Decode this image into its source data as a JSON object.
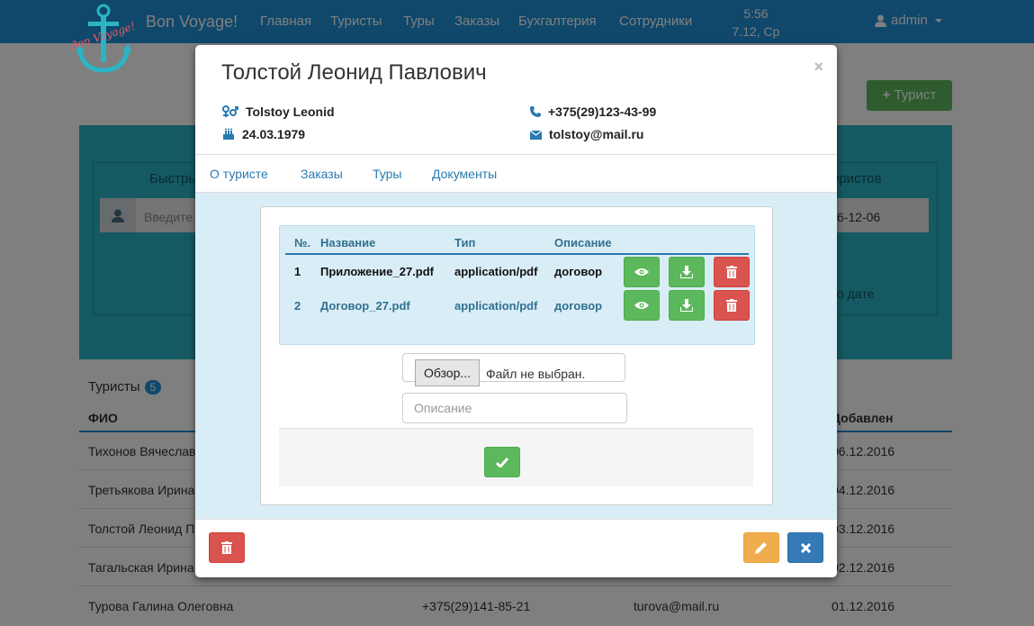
{
  "navbar": {
    "brand": "Bon Voyage!",
    "logo_text": "Bon Voyage!",
    "items": [
      "Главная",
      "Туристы",
      "Туры",
      "Заказы",
      "Бухгалтерия",
      "Сотрудники"
    ],
    "time": "5:56",
    "date": "7.12, Ср",
    "user": "admin"
  },
  "background": {
    "add_button": "Турист",
    "search_title_left": "Быстрь",
    "search_title_right": "уристов",
    "search_placeholder": "Введите",
    "search_date": "6-12-06",
    "by_date": "о дате",
    "list_title": "Туристы",
    "list_count": "5",
    "col_fio": "ФИО",
    "col_added": "Добавлен",
    "rows": [
      {
        "name": "Тихонов Вячеслав",
        "date": "06.12.2016"
      },
      {
        "name": "Третьякова Ирина",
        "date": "04.12.2016"
      },
      {
        "name": "Толстой Леонид П",
        "date": "03.12.2016"
      },
      {
        "name": "Тагальская Ирина",
        "date": "02.12.2016"
      },
      {
        "name": "Турова Галина Олеговна",
        "phone": "+375(29)141-85-21",
        "email": "turova@mail.ru",
        "date": "01.12.2016"
      }
    ]
  },
  "modal": {
    "title": "Толстой Леонид Павлович",
    "latin_name": "Tolstoy Leonid",
    "birthdate": "24.03.1979",
    "phone": "+375(29)123-43-99",
    "email": "tolstoy@mail.ru",
    "tabs": [
      "О туристе",
      "Заказы",
      "Туры",
      "Документы"
    ],
    "active_tab": "Документы",
    "documents": {
      "headers": [
        "№.",
        "Название",
        "Тип",
        "Описание"
      ],
      "rows": [
        {
          "num": "1",
          "name": "Приложение_27.pdf",
          "type": "application/pdf",
          "desc": "договор"
        },
        {
          "num": "2",
          "name": "Договор_27.pdf",
          "type": "application/pdf",
          "desc": "договор"
        }
      ]
    },
    "upload": {
      "browse": "Обзор...",
      "no_file": "Файл не выбран.",
      "description_placeholder": "Описание"
    }
  },
  "colors": {
    "navbar": "#1e90d6",
    "success": "#5cb85c",
    "danger": "#d9534f",
    "warning": "#f0ad4e",
    "primary": "#337ab7",
    "info_bg": "#d9edf7"
  }
}
